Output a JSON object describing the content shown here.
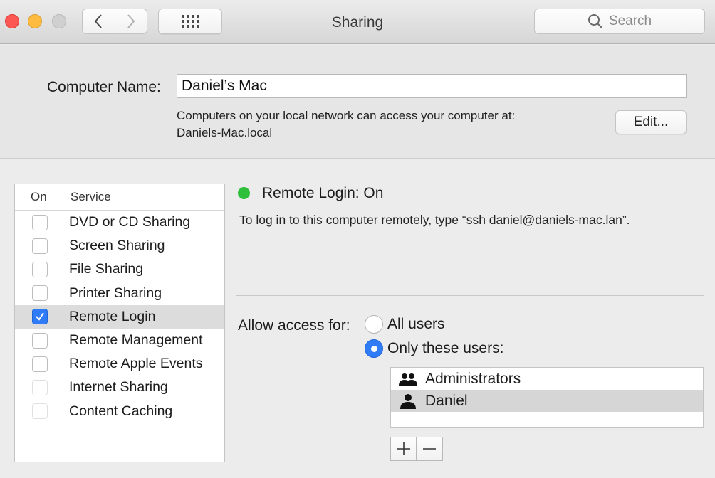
{
  "window": {
    "title": "Sharing"
  },
  "toolbar": {
    "search_placeholder": "Search"
  },
  "computer_name": {
    "label": "Computer Name:",
    "value": "Daniel’s Mac",
    "access_line1": "Computers on your local network can access your computer at:",
    "access_line2": "Daniels-Mac.local",
    "edit_label": "Edit..."
  },
  "services": {
    "header_on": "On",
    "header_service": "Service",
    "items": [
      {
        "name": "DVD or CD Sharing",
        "checked": false,
        "enabled": true
      },
      {
        "name": "Screen Sharing",
        "checked": false,
        "enabled": true
      },
      {
        "name": "File Sharing",
        "checked": false,
        "enabled": true
      },
      {
        "name": "Printer Sharing",
        "checked": false,
        "enabled": true
      },
      {
        "name": "Remote Login",
        "checked": true,
        "enabled": true,
        "selected": true
      },
      {
        "name": "Remote Management",
        "checked": false,
        "enabled": true
      },
      {
        "name": "Remote Apple Events",
        "checked": false,
        "enabled": true
      },
      {
        "name": "Internet Sharing",
        "checked": false,
        "enabled": false
      },
      {
        "name": "Content Caching",
        "checked": false,
        "enabled": false
      }
    ]
  },
  "detail": {
    "status": "Remote Login: On",
    "status_color": "#2ec03a",
    "description": "To log in to this computer remotely, type “ssh daniel@daniels-mac.lan”.",
    "allow_label": "Allow access for:",
    "option_all": "All users",
    "option_only": "Only these users:",
    "selected_option": "only",
    "users": [
      {
        "name": "Administrators",
        "icon": "group-icon"
      },
      {
        "name": "Daniel",
        "icon": "user-icon",
        "selected": true
      }
    ]
  },
  "accent_color": "#2f7cf6"
}
